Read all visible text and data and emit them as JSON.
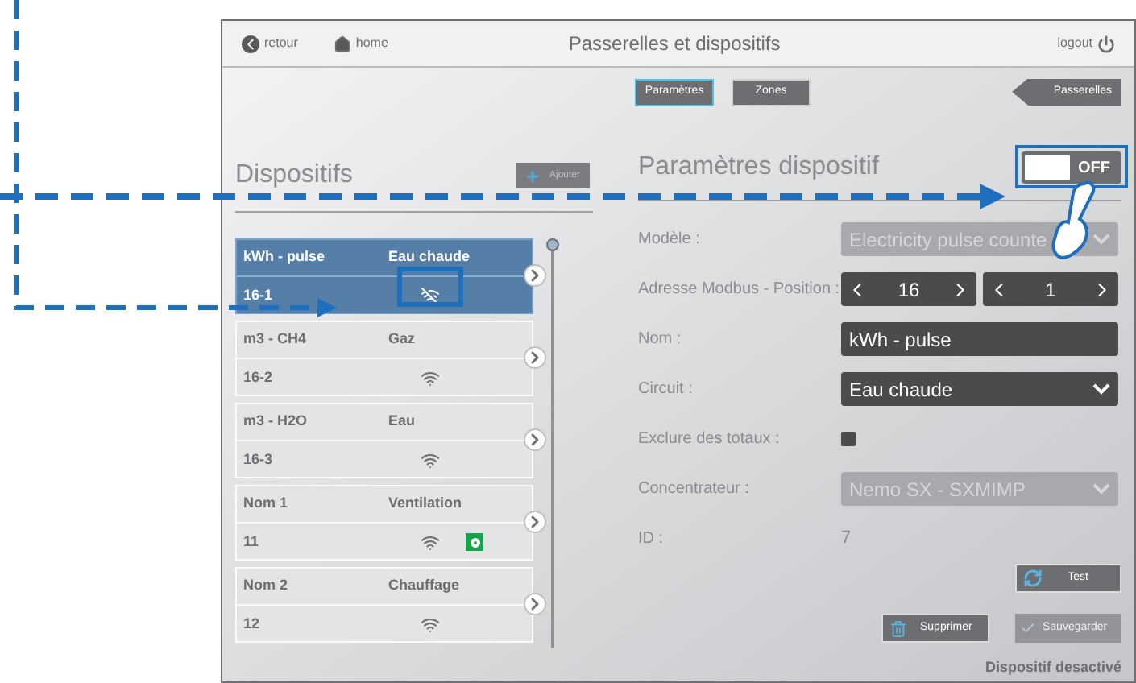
{
  "header": {
    "back": "retour",
    "home": "home",
    "title": "Passerelles et dispositifs",
    "logout": "logout"
  },
  "tabs": [
    {
      "label": "Paramètres",
      "selected": true
    },
    {
      "label": "Zones",
      "selected": false
    }
  ],
  "gateways_button": "Passerelles",
  "devices": {
    "title": "Dispositifs",
    "add": "Ajouter",
    "items": [
      {
        "name": "kWh - pulse",
        "type": "Eau chaude",
        "address": "16-1",
        "selected": true,
        "connected": false,
        "indicator": false
      },
      {
        "name": "m3 - CH4",
        "type": "Gaz",
        "address": "16-2",
        "selected": false,
        "connected": true,
        "indicator": false
      },
      {
        "name": "m3 - H2O",
        "type": "Eau",
        "address": "16-3",
        "selected": false,
        "connected": true,
        "indicator": false
      },
      {
        "name": "Nom 1",
        "type": "Ventilation",
        "address": "11",
        "selected": false,
        "connected": true,
        "indicator": true
      },
      {
        "name": "Nom 2",
        "type": "Chauffage",
        "address": "12",
        "selected": false,
        "connected": true,
        "indicator": false
      }
    ]
  },
  "settings": {
    "title": "Paramètres dispositif",
    "toggle": {
      "on": false,
      "label": "OFF"
    },
    "fields": [
      {
        "kind": "select",
        "label": "Modèle :",
        "value": "Electricity pulse counte",
        "disabled": true
      },
      {
        "kind": "stepper",
        "label": "Adresse Modbus - Position :",
        "values": [
          "16",
          "1"
        ]
      },
      {
        "kind": "text",
        "label": "Nom :",
        "value": "kWh - pulse"
      },
      {
        "kind": "select",
        "label": "Circuit :",
        "value": "Eau chaude",
        "disabled": false
      },
      {
        "kind": "checkbox",
        "label": "Exclure des totaux :",
        "checked": false
      },
      {
        "kind": "select",
        "label": "Concentrateur :",
        "value": "Nemo SX - SXMIMP",
        "disabled": true
      },
      {
        "kind": "value",
        "label": "ID :",
        "value": "7"
      }
    ],
    "test": "Test",
    "delete": "Supprimer",
    "save": {
      "label": "Sauvegarder",
      "disabled": true
    },
    "status": "Dispositif desactivé"
  }
}
